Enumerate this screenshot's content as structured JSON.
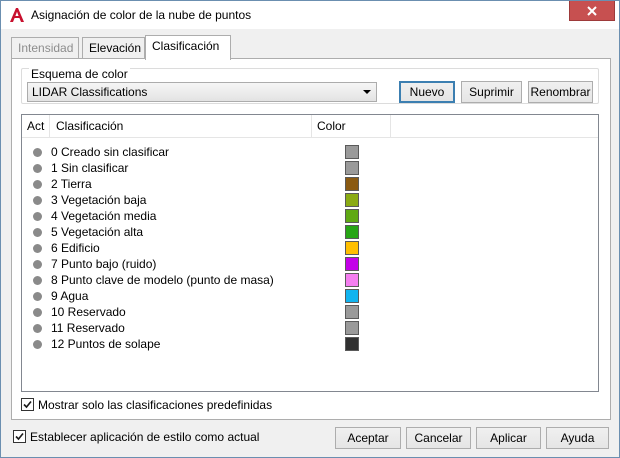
{
  "window": {
    "title": "Asignación de color de la nube de puntos"
  },
  "tabs": [
    {
      "label": "Intensidad",
      "state": "disabled"
    },
    {
      "label": "Elevación",
      "state": "normal"
    },
    {
      "label": "Clasificación",
      "state": "active"
    }
  ],
  "color_scheme": {
    "group_label": "Esquema de color",
    "selected": "LIDAR Classifications",
    "buttons": {
      "new": "Nuevo",
      "delete": "Suprimir",
      "rename": "Renombrar"
    }
  },
  "table": {
    "headers": {
      "active": "Act",
      "classification": "Clasificación",
      "color": "Color"
    },
    "rows": [
      {
        "label": "0 Creado sin clasificar",
        "color": "#9a9a9a"
      },
      {
        "label": "1 Sin clasificar",
        "color": "#9a9a9a"
      },
      {
        "label": "2 Tierra",
        "color": "#8a5a12"
      },
      {
        "label": "3 Vegetación baja",
        "color": "#8aab14"
      },
      {
        "label": "4 Vegetación media",
        "color": "#5fa914"
      },
      {
        "label": "5 Vegetación alta",
        "color": "#27a515"
      },
      {
        "label": "6 Edificio",
        "color": "#ffbf00"
      },
      {
        "label": "7 Punto bajo (ruido)",
        "color": "#c300e8"
      },
      {
        "label": "8 Punto clave de modelo (punto de masa)",
        "color": "#f47ef0"
      },
      {
        "label": "9 Agua",
        "color": "#12b4ef"
      },
      {
        "label": "10 Reservado",
        "color": "#9a9a9a"
      },
      {
        "label": "11 Reservado",
        "color": "#9a9a9a"
      },
      {
        "label": "12 Puntos de solape",
        "color": "#303030"
      }
    ]
  },
  "options": {
    "show_predefined": {
      "label": "Mostrar solo las clasificaciones predefinidas",
      "checked": true
    },
    "set_as_current": {
      "label": "Establecer aplicación de estilo como actual",
      "checked": true
    }
  },
  "footer": {
    "accept": "Aceptar",
    "cancel": "Cancelar",
    "apply": "Aplicar",
    "help": "Ayuda"
  },
  "colors": {
    "accent": "#3c7fb1",
    "close": "#c75050",
    "app_icon": "#c8102e"
  }
}
